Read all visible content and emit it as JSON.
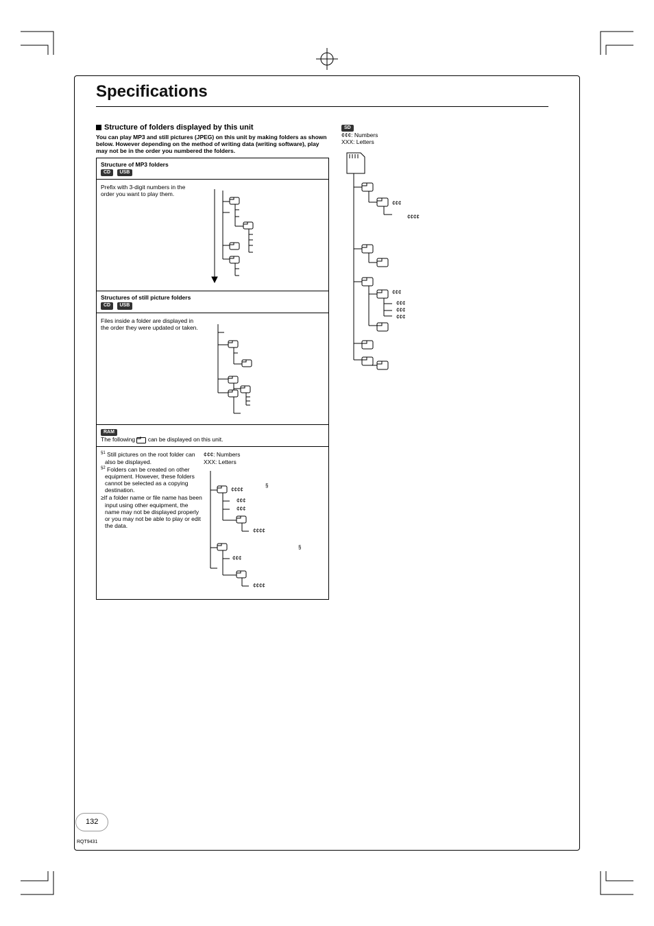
{
  "title": "Specifications",
  "heading": "Structure of folders displayed by this unit",
  "intro": "You can play MP3 and still pictures (JPEG) on this unit by making folders as shown below. However depending on the method of writing data (writing software), play may not be in the order you numbered the folders.",
  "box_mp3": {
    "title": "Structure of MP3 folders",
    "badges": [
      "CD",
      "USB"
    ],
    "text": "Prefix with 3-digit numbers in the order you want to play them."
  },
  "box_still": {
    "title": "Structures of still picture folders",
    "badges": [
      "CD",
      "USB"
    ],
    "text": "Files inside a folder are displayed in the order they were updated or taken."
  },
  "ram": {
    "badge": "RAM",
    "intro_pre": "The following ",
    "intro_post": " can be displayed on this unit.",
    "note_sup1": "§1",
    "note1": " Still pictures on the root folder can also be displayed.",
    "note_sup2": "§2",
    "note2": " Folders can be created on other equipment. However, these folders cannot be selected as a copying destination.",
    "bullet": "If a folder name or file name has been input using other equipment, the name may not be displayed properly or you may not be able to play or edit the data.",
    "star_numbers": "¢¢¢: Numbers",
    "xxx_letters": "XXX: Letters",
    "lbl_stars4": "¢¢¢¢",
    "lbl_stars3": "¢¢¢",
    "ref2": "§"
  },
  "sd": {
    "badge": "SD",
    "star_numbers": "¢¢¢: Numbers",
    "xxx_letters": "XXX: Letters",
    "lbl_stars3": "¢¢¢",
    "lbl_stars4": "¢¢¢¢"
  },
  "page_number": "132",
  "doc_id": "RQT9431"
}
